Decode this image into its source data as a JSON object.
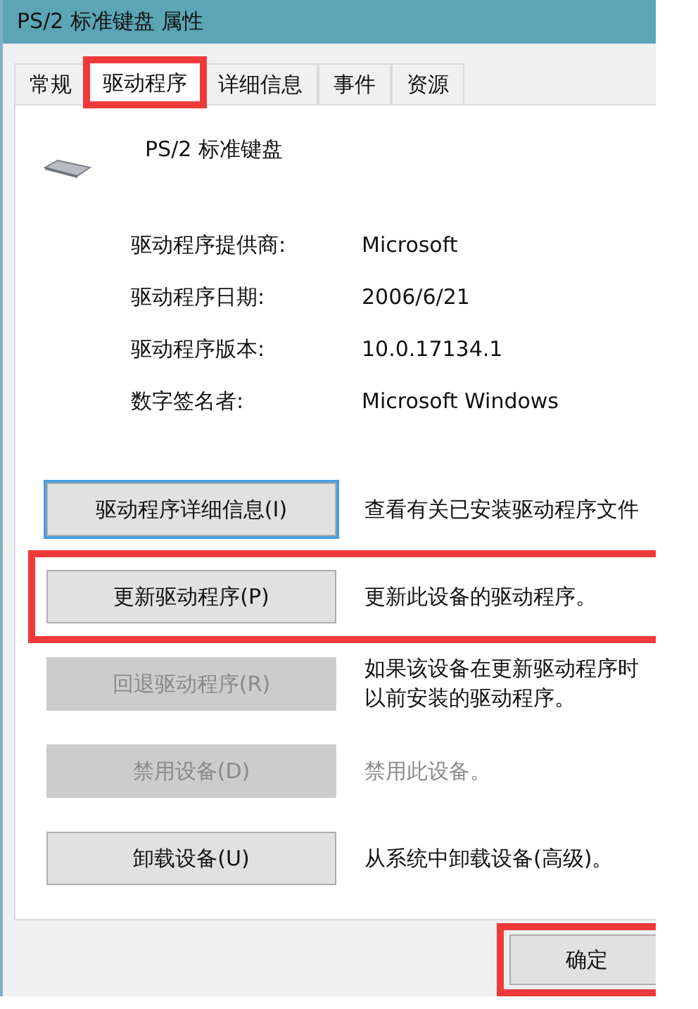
{
  "window": {
    "title": "PS/2 标准键盘 属性"
  },
  "tabs": [
    {
      "label": "常规",
      "selected": false,
      "highlighted": false
    },
    {
      "label": "驱动程序",
      "selected": true,
      "highlighted": true
    },
    {
      "label": "详细信息",
      "selected": false,
      "highlighted": false
    },
    {
      "label": "事件",
      "selected": false,
      "highlighted": false
    },
    {
      "label": "资源",
      "selected": false,
      "highlighted": false
    }
  ],
  "device": {
    "name": "PS/2 标准键盘"
  },
  "properties": [
    {
      "label": "驱动程序提供商:",
      "value": "Microsoft"
    },
    {
      "label": "驱动程序日期:",
      "value": "2006/6/21"
    },
    {
      "label": "驱动程序版本:",
      "value": "10.0.17134.1"
    },
    {
      "label": "数字签名者:",
      "value": "Microsoft Windows"
    }
  ],
  "actions": [
    {
      "button": "驱动程序详细信息(I)",
      "description": "查看有关已安装驱动程序文件",
      "disabled": false,
      "focused": true,
      "description_greyed": false,
      "highlighted": false
    },
    {
      "button": "更新驱动程序(P)",
      "description": "更新此设备的驱动程序。",
      "disabled": false,
      "focused": false,
      "description_greyed": false,
      "highlighted": true
    },
    {
      "button": "回退驱动程序(R)",
      "description": "如果该设备在更新驱动程序时",
      "description_line_2": "以前安装的驱动程序。",
      "disabled": true,
      "focused": false,
      "description_greyed": false,
      "highlighted": false
    },
    {
      "button": "禁用设备(D)",
      "description": "禁用此设备。",
      "disabled": true,
      "focused": false,
      "description_greyed": true,
      "highlighted": false
    },
    {
      "button": "卸载设备(U)",
      "description": "从系统中卸载设备(高级)。",
      "disabled": false,
      "focused": false,
      "description_greyed": false,
      "highlighted": false
    }
  ],
  "footer": {
    "ok_button": {
      "label": "确定",
      "highlighted": true
    }
  }
}
